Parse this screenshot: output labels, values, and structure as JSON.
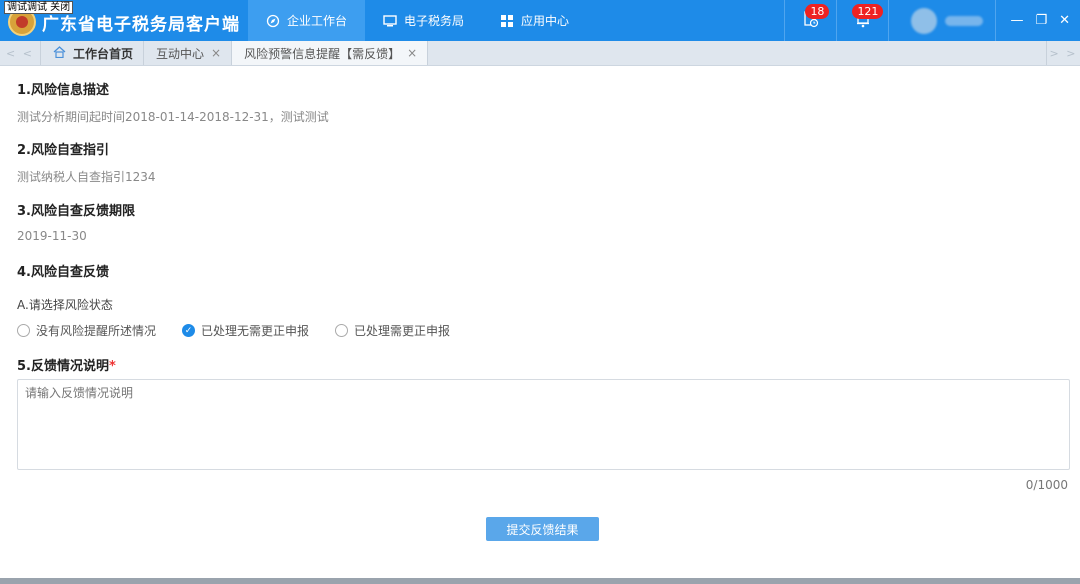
{
  "header": {
    "debug_tag": "调试调试 关闭",
    "app_title": "广东省电子税务局客户端",
    "nav": [
      {
        "label": "企业工作台",
        "icon": "compass-icon",
        "active": true
      },
      {
        "label": "电子税务局",
        "icon": "monitor-icon",
        "active": false
      },
      {
        "label": "应用中心",
        "icon": "grid-icon",
        "active": false
      }
    ],
    "todo_count": "18",
    "notice_count": "121",
    "window_controls": [
      "—",
      "❐",
      "✕"
    ]
  },
  "tabs": {
    "scroll_left": "< <",
    "scroll_right": "> >",
    "items": [
      {
        "label": "工作台首页",
        "closable": false
      },
      {
        "label": "互动中心",
        "closable": true
      },
      {
        "label": "风险预警信息提醒【需反馈】",
        "closable": true
      }
    ],
    "close_glyph": "×"
  },
  "sections": {
    "s1_title": "1.风险信息描述",
    "s1_text": "测试分析期间起时间2018-01-14-2018-12-31，测试测试",
    "s2_title": "2.风险自查指引",
    "s2_text": "测试纳税人自查指引1234",
    "s3_title": "3.风险自查反馈期限",
    "s3_text": "2019-11-30",
    "s4_title": "4.风险自查反馈",
    "s4_sub": "A.请选择风险状态",
    "radios": [
      {
        "label": "没有风险提醒所述情况",
        "checked": false
      },
      {
        "label": "已处理无需更正申报",
        "checked": true
      },
      {
        "label": "已处理需更正申报",
        "checked": false
      }
    ],
    "s5_title": "5.反馈情况说明",
    "s5_required": "*",
    "textarea_placeholder": "请输入反馈情况说明",
    "char_count": "0/1000",
    "submit_label": "提交反馈结果"
  }
}
